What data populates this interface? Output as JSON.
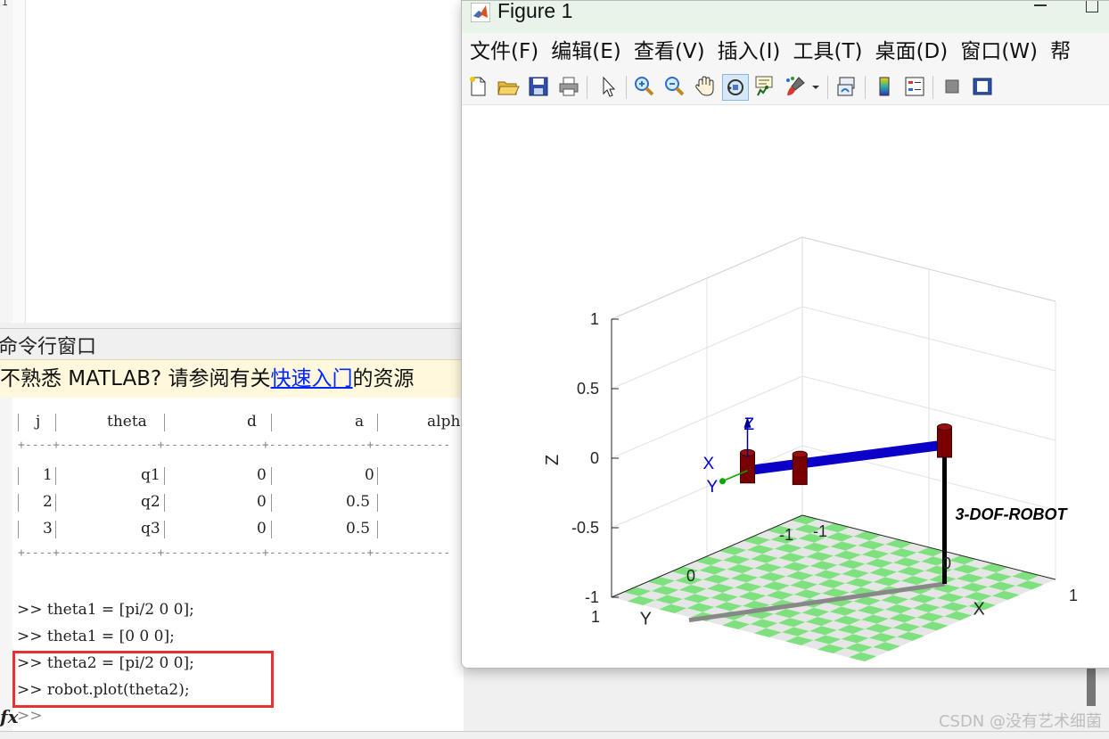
{
  "command_window": {
    "title": "命令行窗口",
    "tip_prefix": "不熟悉 MATLAB? 请参阅有关",
    "tip_link": "快速入门",
    "tip_suffix": "的资源",
    "table": {
      "headers": [
        "j",
        "theta",
        "d",
        "a",
        "alph"
      ],
      "rows": [
        [
          "1",
          "q1",
          "0",
          "0"
        ],
        [
          "2",
          "q2",
          "0",
          "0.5"
        ],
        [
          "3",
          "q3",
          "0",
          "0.5"
        ]
      ]
    },
    "commands": [
      ">> theta1 = [pi/2 0 0];",
      ">> theta1 = [0 0 0];",
      ">> theta2 = [pi/2 0 0];",
      ">> robot.plot(theta2);"
    ],
    "prompt": ">>",
    "fx_label": "fx"
  },
  "figure_window": {
    "title": "Figure 1",
    "menu": [
      "文件(F)",
      "编辑(E)",
      "查看(V)",
      "插入(I)",
      "工具(T)",
      "桌面(D)",
      "窗口(W)",
      "帮"
    ],
    "toolbar_icons": [
      "new-figure-icon",
      "open-file-icon",
      "save-icon",
      "print-icon",
      "pointer-icon",
      "zoom-in-icon",
      "zoom-out-icon",
      "pan-icon",
      "rotate-3d-icon",
      "data-cursor-icon",
      "brush-icon",
      "link-plot-icon",
      "colorbar-icon",
      "legend-icon",
      "hide-plot-tools-icon",
      "show-plot-tools-icon"
    ]
  },
  "chart_data": {
    "type": "3d-robot-plot",
    "robot_name": "3-DOF-ROBOT",
    "xlabel": "X",
    "ylabel": "Y",
    "zlabel": "Z",
    "xlim": [
      -1,
      1
    ],
    "ylim": [
      -1,
      1
    ],
    "zlim": [
      -1,
      1
    ],
    "x_ticks": [
      "-1",
      "0",
      "1"
    ],
    "y_ticks": [
      "-1",
      "0",
      "1"
    ],
    "z_ticks": [
      "-1",
      "-0.5",
      "0",
      "0.5",
      "1"
    ],
    "tool_frame_labels": [
      "X",
      "Y",
      "Z"
    ],
    "colors": {
      "link": "#0a00c8",
      "joint": "#7a0000",
      "base_column": "#000000",
      "shadow": "#888888",
      "floor_a": "#7fe07f",
      "floor_b": "#e6e6e6",
      "frame_x": "#0000cc",
      "frame_y": "#00aa00",
      "frame_z": "#000080"
    }
  },
  "watermark": "CSDN @没有艺术细菌"
}
